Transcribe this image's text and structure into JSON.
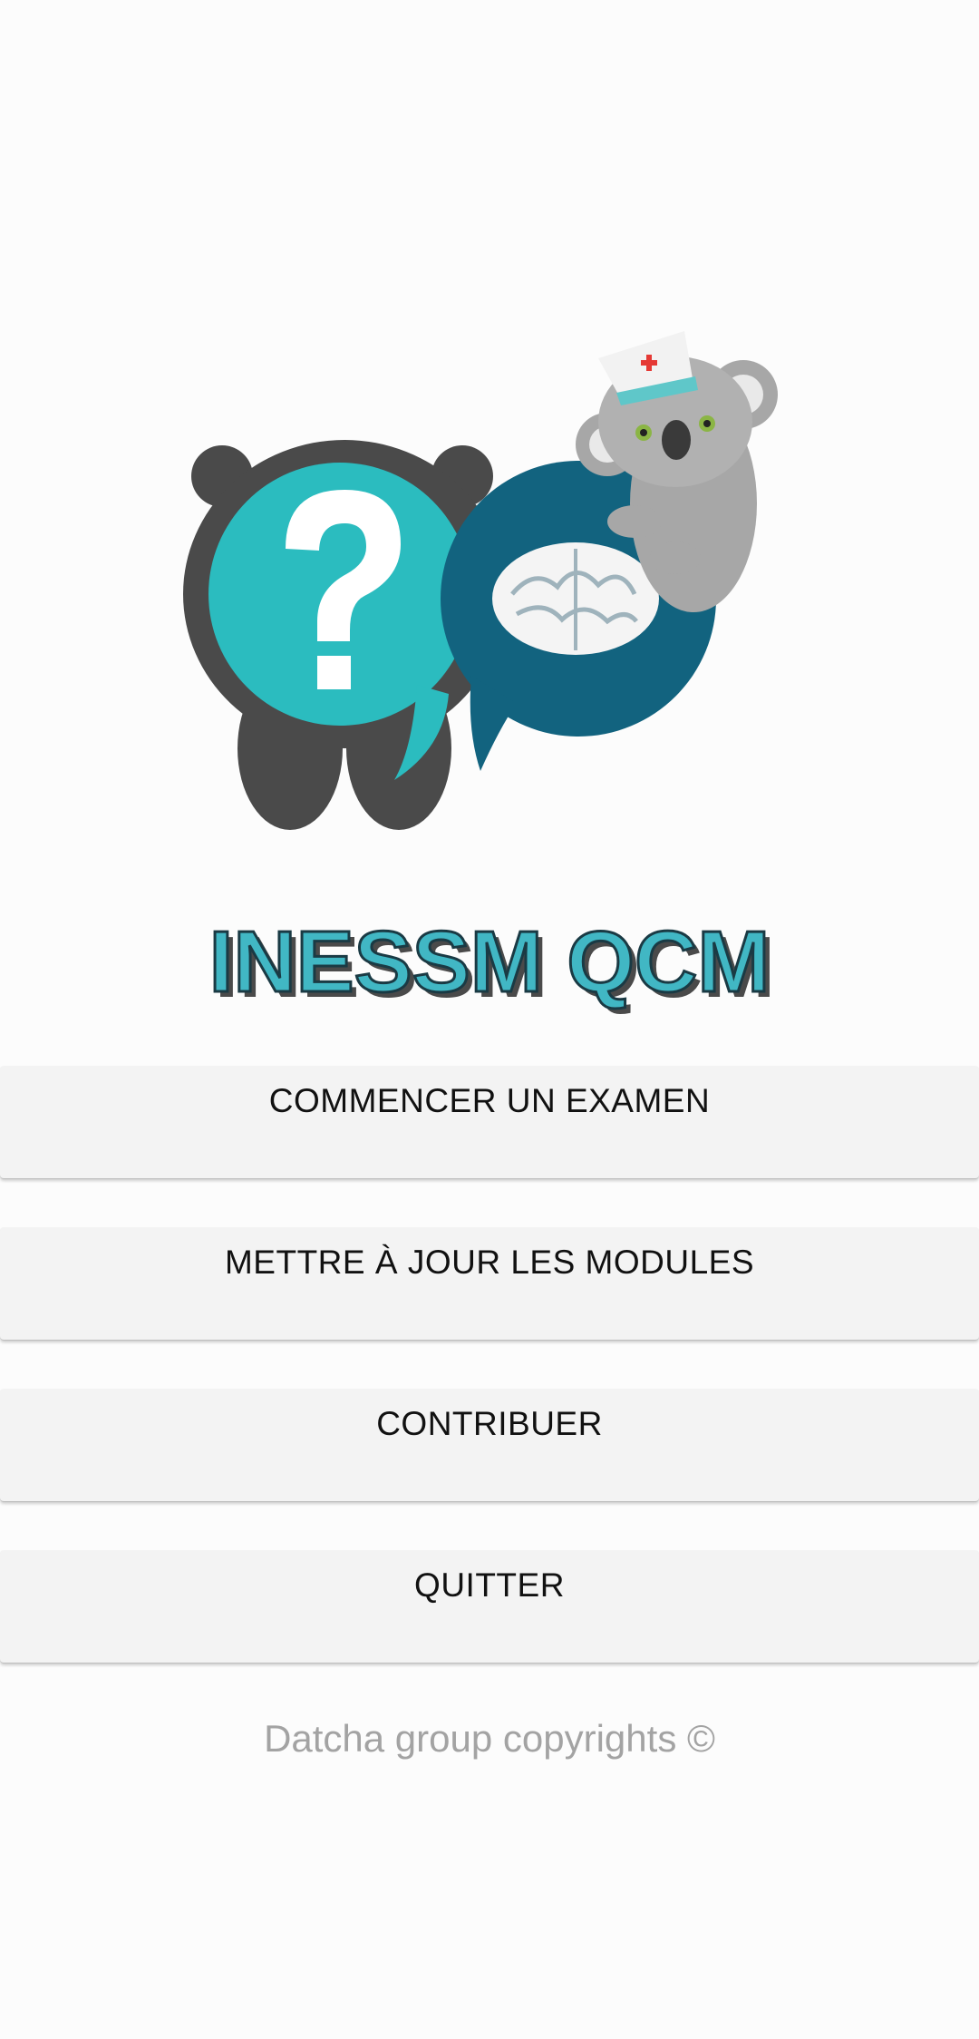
{
  "app": {
    "logo_text": "INESSM QCM",
    "logo_icon": "koala-bear-quiz-logo"
  },
  "menu": {
    "start_exam_label": "COMMENCER UN EXAMEN",
    "update_modules_label": "METTRE À JOUR LES MODULES",
    "contribute_label": "CONTRIBUER",
    "quit_label": "QUITTER"
  },
  "footer": {
    "copyright": "Datcha group copyrights ©"
  },
  "colors": {
    "teal": "#2bbcbf",
    "dark_blue": "#12637f",
    "dark_gray": "#4a4a4a",
    "button_bg": "#f3f3f3",
    "footer_text": "#a3a3a3"
  }
}
